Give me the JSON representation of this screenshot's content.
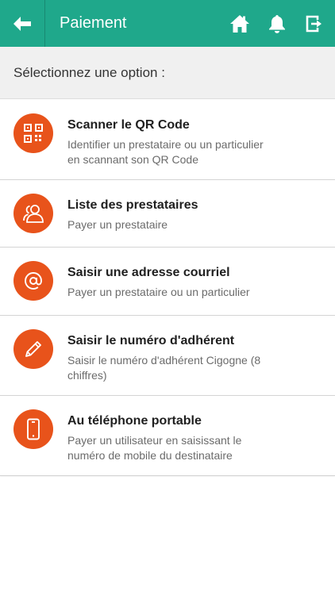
{
  "header": {
    "title": "Paiement",
    "bg_color": "#1fa88b",
    "back_icon": "arrow-left-icon",
    "actions": [
      {
        "icon": "home-icon"
      },
      {
        "icon": "bell-icon"
      },
      {
        "icon": "logout-icon"
      }
    ]
  },
  "subheader": {
    "text": "Sélectionnez une option :"
  },
  "accent_color": "#e8531b",
  "options": [
    {
      "icon": "qr-code-icon",
      "title": "Scanner le QR Code",
      "desc_lines": [
        "Identifier un prestataire ou un particulier",
        "en scannant son QR Code"
      ]
    },
    {
      "icon": "users-icon",
      "title": "Liste des prestataires",
      "desc_lines": [
        "Payer un prestataire"
      ]
    },
    {
      "icon": "at-sign-icon",
      "title": "Saisir une adresse courriel",
      "desc_lines": [
        "Payer un prestataire ou un particulier"
      ]
    },
    {
      "icon": "pencil-icon",
      "title": "Saisir le numéro d'adhérent",
      "desc_lines": [
        "Saisir le numéro d'adhérent Cigogne (8",
        "chiffres)"
      ]
    },
    {
      "icon": "mobile-phone-icon",
      "title": "Au téléphone portable",
      "desc_lines": [
        "Payer un utilisateur en saisissant le",
        "numéro de mobile du destinataire"
      ]
    }
  ]
}
